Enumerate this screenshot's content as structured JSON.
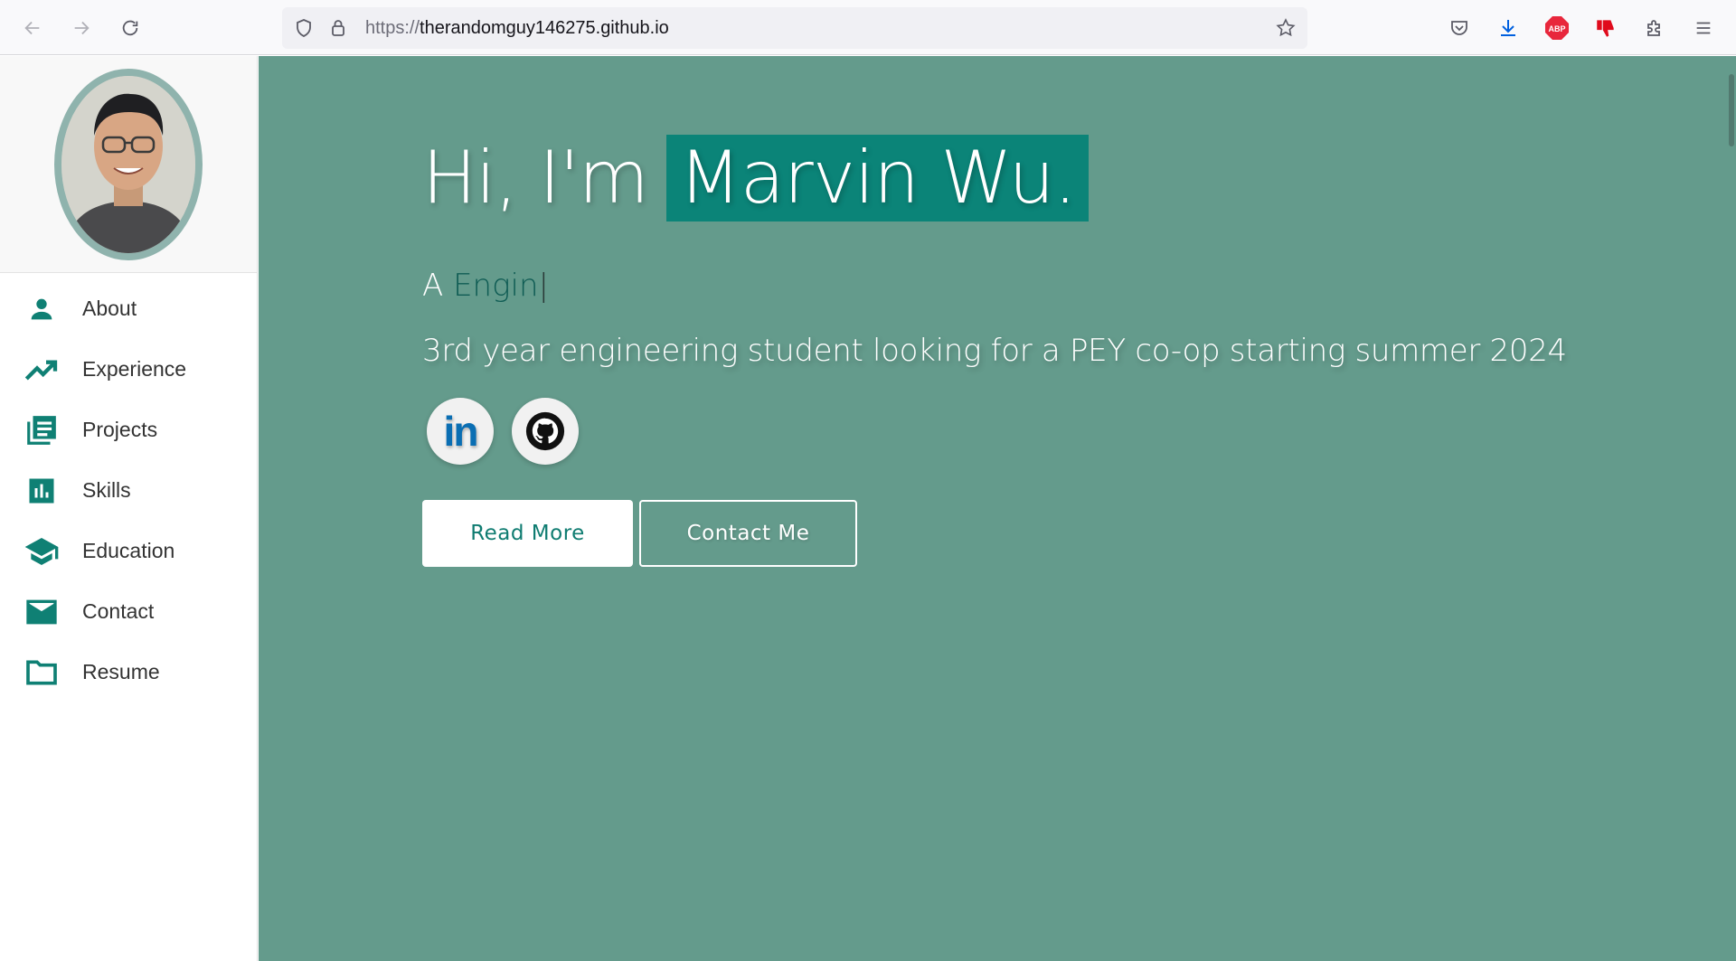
{
  "browser": {
    "url_scheme": "https://",
    "url_host": "therandomguy146275.github.io"
  },
  "sidebar": {
    "items": [
      {
        "label": "About",
        "icon": "person-icon"
      },
      {
        "label": "Experience",
        "icon": "trending-up-icon"
      },
      {
        "label": "Projects",
        "icon": "library-books-icon"
      },
      {
        "label": "Skills",
        "icon": "bar-chart-icon"
      },
      {
        "label": "Education",
        "icon": "graduation-cap-icon"
      },
      {
        "label": "Contact",
        "icon": "mail-icon"
      },
      {
        "label": "Resume",
        "icon": "folder-icon"
      }
    ]
  },
  "hero": {
    "greeting": "Hi, I'm",
    "name": "Marvin Wu.",
    "typed_prefix": "A",
    "typed_word": "Engin",
    "typed_cursor": "|",
    "subtitle": "3rd year engineering student looking for a PEY co-op starting summer 2024",
    "read_more": "Read More",
    "contact_me": "Contact Me",
    "linkedin_glyph": "in"
  },
  "colors": {
    "hero_bg": "#649b8c",
    "accent": "#0b8478",
    "sidebar_icon": "#0f8074"
  }
}
